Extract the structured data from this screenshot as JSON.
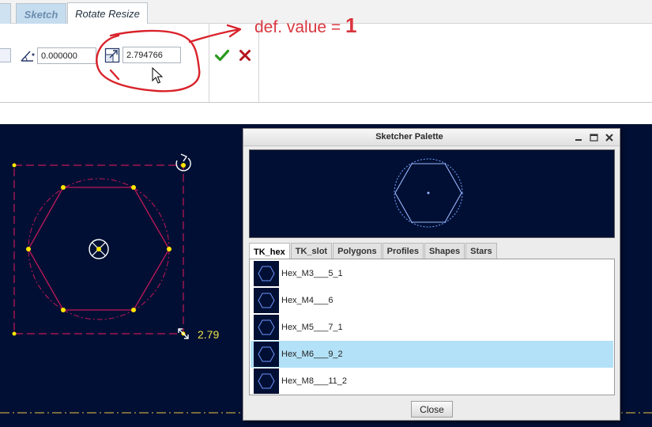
{
  "ribbon": {
    "tabs": [
      {
        "label": ""
      },
      {
        "label": "Sketch"
      },
      {
        "label": "Rotate Resize"
      }
    ],
    "rotation_field": {
      "value": "0.000000",
      "icon": "rotate-angle-icon"
    },
    "scale_field": {
      "value": "2.794766",
      "icon": "scale-icon"
    },
    "ok_icon": "checkmark-icon",
    "cancel_icon": "close-x-icon"
  },
  "annotation": {
    "text": "def. value = ",
    "value": "1",
    "color": "#d9363e"
  },
  "canvas": {
    "dimension_label": "2.79",
    "background": "#000f33",
    "line_color": "#c2185b",
    "handle_color": "#ffe600"
  },
  "palette": {
    "title": "Sketcher Palette",
    "window_buttons": [
      "minimize",
      "maximize",
      "close"
    ],
    "tabs": [
      "TK_hex",
      "TK_slot",
      "Polygons",
      "Profiles",
      "Shapes",
      "Stars"
    ],
    "active_tab": "TK_hex",
    "items": [
      {
        "label": "Hex_M3___5_1",
        "selected": false
      },
      {
        "label": "Hex_M4___6",
        "selected": false
      },
      {
        "label": "Hex_M5___7_1",
        "selected": false
      },
      {
        "label": "Hex_M6___9_2",
        "selected": true
      },
      {
        "label": "Hex_M8___11_2",
        "selected": false
      }
    ],
    "close_label": "Close",
    "selection_color": "#b3e1f7"
  }
}
